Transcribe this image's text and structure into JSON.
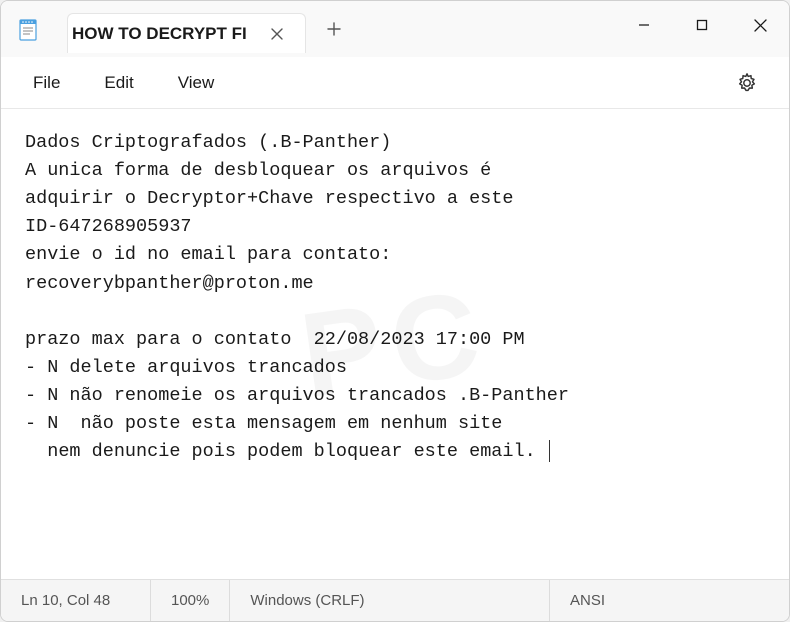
{
  "window": {
    "tab_title": "HOW TO DECRYPT FI",
    "controls": {
      "minimize": "—",
      "maximize": "☐",
      "close": "✕"
    }
  },
  "menu": {
    "file": "File",
    "edit": "Edit",
    "view": "View"
  },
  "document": {
    "content": "Dados Criptografados (.B-Panther)\nA unica forma de desbloquear os arquivos é\nadquirir o Decryptor+Chave respectivo a este\nID-647268905937\nenvie o id no email para contato:\nrecoverybpanther@proton.me\n\nprazo max para o contato  22/08/2023 17:00 PM\n- N delete arquivos trancados\n- N não renomeie os arquivos trancados .B-Panther\n- N  não poste esta mensagem em nenhum site\n  nem denuncie pois podem bloquear este email. "
  },
  "statusbar": {
    "position": "Ln 10, Col 48",
    "zoom": "100%",
    "line_ending": "Windows (CRLF)",
    "encoding": "ANSI"
  }
}
